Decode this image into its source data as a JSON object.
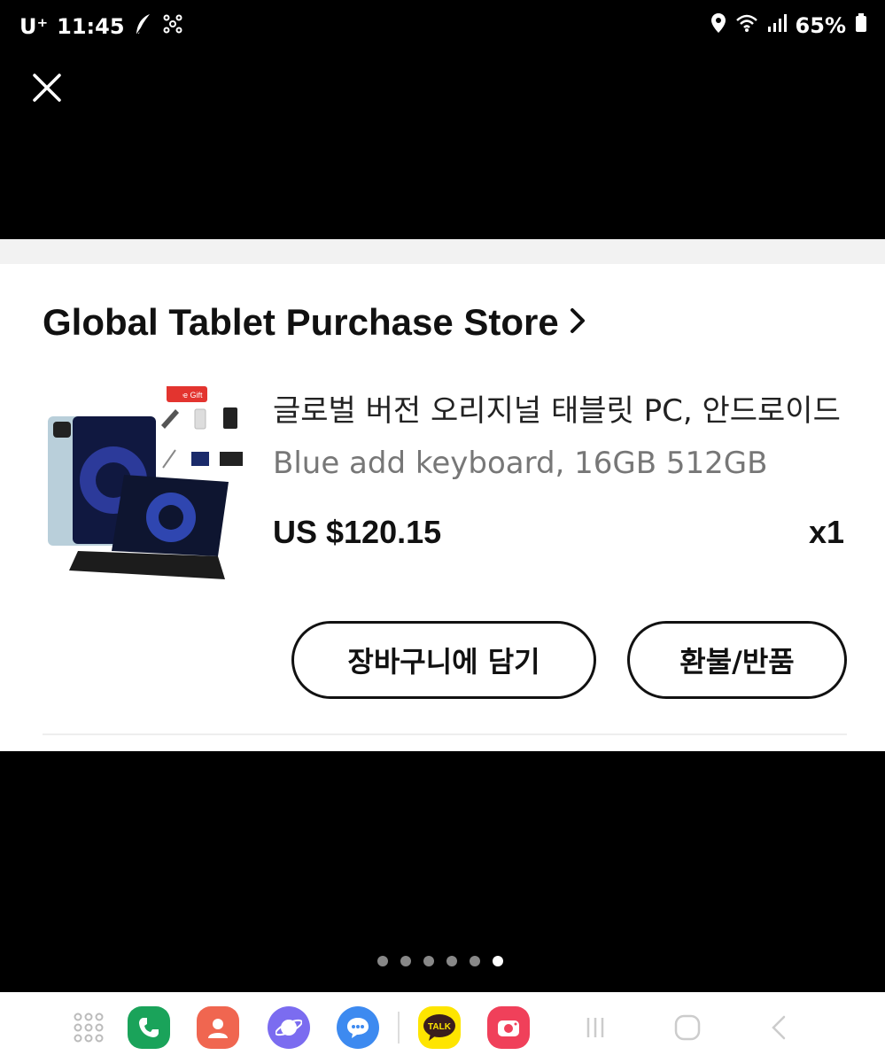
{
  "status_bar": {
    "carrier": "U⁺",
    "time": "11:45",
    "battery": "65%"
  },
  "order": {
    "store_name": "Global Tablet Purchase Store",
    "product_title": "글로벌 버전 오리지널 태블릿 PC, 안드로이드",
    "variant": "Blue add keyboard, 16GB 512GB",
    "price": "US $120.15",
    "quantity": "x1",
    "thumbnail_gift_label": "Free Gift"
  },
  "buttons": {
    "add_to_cart": "장바구니에 담기",
    "refund_return": "환불/반품"
  },
  "pager": {
    "count": 6,
    "active_index": 5
  },
  "dock": {
    "kakao_label": "TALK",
    "apps": [
      "apps-grid-icon",
      "phone-icon",
      "contacts-icon",
      "internet-icon",
      "messages-icon",
      "kakaotalk-icon",
      "camera-icon",
      "recents-icon",
      "home-icon",
      "back-icon"
    ]
  },
  "colors": {
    "phone": "#1aa35a",
    "contacts": "#f06650",
    "internet": "#7b6cf0",
    "messages": "#3d8af0",
    "kakao": "#fee500",
    "camera": "#f0405a"
  }
}
